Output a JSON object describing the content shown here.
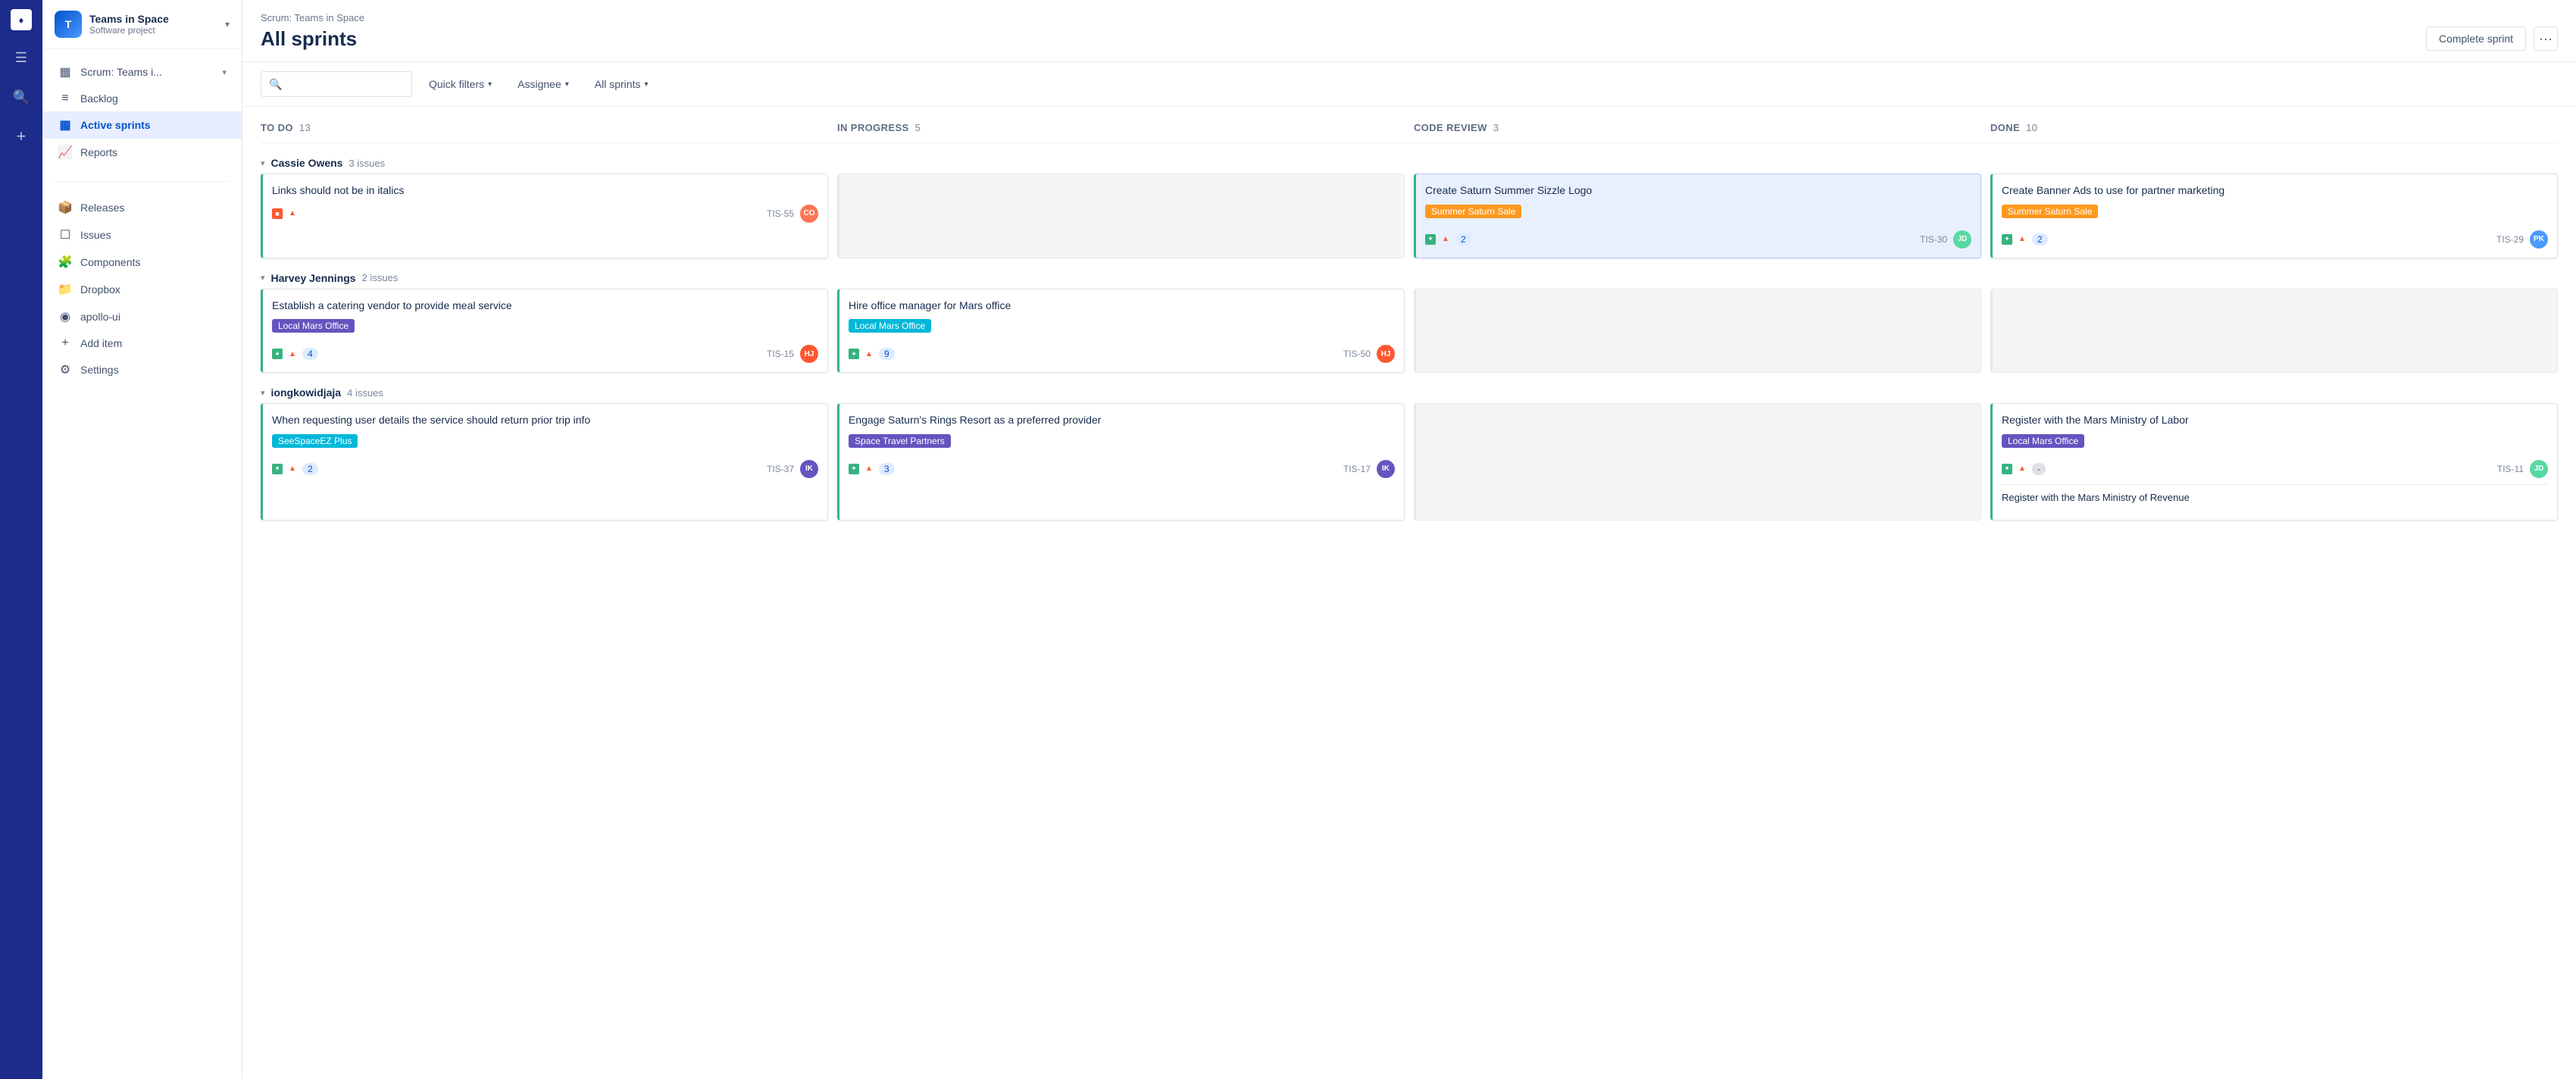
{
  "rail": {
    "logo": "♦",
    "icons": [
      "☰",
      "🔍",
      "+"
    ]
  },
  "sidebar": {
    "project_name": "Teams in Space",
    "project_sub": "Software project",
    "project_initials": "T",
    "nav_items": [
      {
        "id": "scrum",
        "label": "Scrum: Teams i...",
        "icon": "▦",
        "active": false,
        "has_arrow": true
      },
      {
        "id": "backlog",
        "label": "Backlog",
        "icon": "☰",
        "active": false
      },
      {
        "id": "active-sprints",
        "label": "Active sprints",
        "icon": "▦",
        "active": true
      },
      {
        "id": "reports",
        "label": "Reports",
        "icon": "📈",
        "active": false
      }
    ],
    "secondary_items": [
      {
        "id": "releases",
        "label": "Releases",
        "icon": "📦"
      },
      {
        "id": "issues",
        "label": "Issues",
        "icon": "☐"
      },
      {
        "id": "components",
        "label": "Components",
        "icon": "🧩"
      },
      {
        "id": "dropbox",
        "label": "Dropbox",
        "icon": "📁"
      },
      {
        "id": "apollo-ui",
        "label": "apollo-ui",
        "icon": "◉"
      },
      {
        "id": "add-item",
        "label": "Add item",
        "icon": "+"
      },
      {
        "id": "settings",
        "label": "Settings",
        "icon": "⚙"
      }
    ]
  },
  "header": {
    "breadcrumb": "Scrum: Teams in Space",
    "title": "All sprints",
    "complete_sprint_label": "Complete sprint",
    "more_label": "···"
  },
  "filters": {
    "search_placeholder": "",
    "quick_filters_label": "Quick filters",
    "assignee_label": "Assignee",
    "all_sprints_label": "All sprints"
  },
  "columns": [
    {
      "id": "todo",
      "label": "TO DO",
      "count": 13
    },
    {
      "id": "in-progress",
      "label": "IN PROGRESS",
      "count": 5
    },
    {
      "id": "code-review",
      "label": "CODE REVIEW",
      "count": 3
    },
    {
      "id": "done",
      "label": "DONE",
      "count": 10
    }
  ],
  "sections": [
    {
      "id": "cassie",
      "name": "Cassie Owens",
      "issues_label": "3 issues",
      "cards": [
        {
          "col": 0,
          "title": "Links should not be in italics",
          "tag": null,
          "icon_type": "story",
          "priority": "high",
          "badge": null,
          "id_label": "TIS-55",
          "avatar_class": "av1",
          "avatar_initials": "CO",
          "border_color": "#36b37e",
          "highlight": false
        },
        {
          "col": 1,
          "empty": true
        },
        {
          "col": 2,
          "title": "Create Saturn Summer Sizzle Logo",
          "tag": "Summer Saturn Sale",
          "tag_class": "tag-orange",
          "icon_type": "story",
          "priority": "high",
          "badge": "2",
          "id_label": "TIS-30",
          "avatar_class": "av2",
          "avatar_initials": "JD",
          "border_color": "#36b37e",
          "highlight": true
        },
        {
          "col": 3,
          "title": "Create Banner Ads to use for partner marketing",
          "tag": "Summer Saturn Sale",
          "tag_class": "tag-orange",
          "icon_type": "story",
          "priority": "high",
          "badge": "2",
          "id_label": "TIS-29",
          "avatar_class": "av3",
          "avatar_initials": "PK",
          "border_color": "#36b37e",
          "highlight": false
        }
      ]
    },
    {
      "id": "harvey",
      "name": "Harvey Jennings",
      "issues_label": "2 issues",
      "cards": [
        {
          "col": 0,
          "title": "Establish a catering vendor to provide meal service",
          "tag": "Local Mars Office",
          "tag_class": "tag-purple",
          "icon_type": "story",
          "priority": "high",
          "badge": "4",
          "id_label": "TIS-15",
          "avatar_class": "av4",
          "avatar_initials": "HJ",
          "border_color": "#36b37e",
          "highlight": false
        },
        {
          "col": 1,
          "title": "Hire office manager for Mars office",
          "tag": "Local Mars Office",
          "tag_class": "tag-teal",
          "icon_type": "story",
          "priority": "high",
          "badge": "9",
          "id_label": "TIS-50",
          "avatar_class": "av4",
          "avatar_initials": "HJ",
          "border_color": "#36b37e",
          "highlight": false
        },
        {
          "col": 2,
          "empty": true
        },
        {
          "col": 3,
          "empty": true
        }
      ]
    },
    {
      "id": "iong",
      "name": "iongkowidjaja",
      "issues_label": "4 issues",
      "cards": [
        {
          "col": 0,
          "title": "When requesting user details the service should return prior trip info",
          "tag": "SeeSpaceEZ Plus",
          "tag_class": "tag-teal",
          "icon_type": "story",
          "priority": "high",
          "badge": "2",
          "id_label": "TIS-37",
          "avatar_class": "av5",
          "avatar_initials": "IK",
          "border_color": "#36b37e",
          "highlight": false
        },
        {
          "col": 1,
          "title": "Engage Saturn's Rings Resort as a preferred provider",
          "tag": "Space Travel Partners",
          "tag_class": "tag-purple",
          "icon_type": "story",
          "priority": "high",
          "badge": "3",
          "id_label": "TIS-17",
          "avatar_class": "av5",
          "avatar_initials": "IK",
          "border_color": "#36b37e",
          "highlight": false
        },
        {
          "col": 2,
          "empty": true
        },
        {
          "col": 3,
          "title": "Register with the Mars Ministry of Labor",
          "tag": "Local Mars Office",
          "tag_class": "tag-purple",
          "icon_type": "story",
          "priority": "high",
          "badge": "-",
          "id_label": "TIS-11",
          "avatar_class": "av2",
          "avatar_initials": "JD",
          "border_color": "#36b37e",
          "highlight": false,
          "extra_text": "Register with the Mars Ministry of Revenue"
        }
      ]
    }
  ]
}
